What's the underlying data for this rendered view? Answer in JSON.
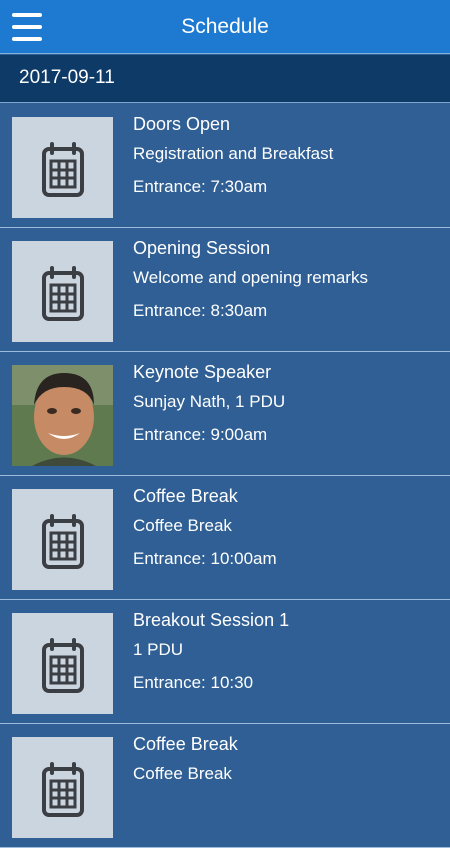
{
  "header": {
    "title": "Schedule",
    "menu_icon": "hamburger-menu-icon"
  },
  "date": "2017-09-11",
  "colors": {
    "app_bar": "#1e7ad1",
    "date_bar": "#0d3a66",
    "list_bg": "#2f5f94",
    "thumb_bg": "#cbd5e0"
  },
  "items": [
    {
      "title": "Doors Open",
      "subtitle": "Registration and Breakfast",
      "time": "Entrance: 7:30am",
      "icon": "calendar-icon"
    },
    {
      "title": "Opening Session",
      "subtitle": "Welcome and opening remarks",
      "time": "Entrance: 8:30am",
      "icon": "calendar-icon"
    },
    {
      "title": "Keynote Speaker",
      "subtitle": "Sunjay Nath, 1 PDU",
      "time": "Entrance: 9:00am",
      "icon": "speaker-photo"
    },
    {
      "title": "Coffee Break",
      "subtitle": "Coffee Break",
      "time": "Entrance: 10:00am",
      "icon": "calendar-icon"
    },
    {
      "title": "Breakout Session 1",
      "subtitle": "1 PDU",
      "time": "Entrance: 10:30",
      "icon": "calendar-icon"
    },
    {
      "title": "Coffee Break",
      "subtitle": "Coffee Break",
      "time": "",
      "icon": "calendar-icon"
    }
  ]
}
